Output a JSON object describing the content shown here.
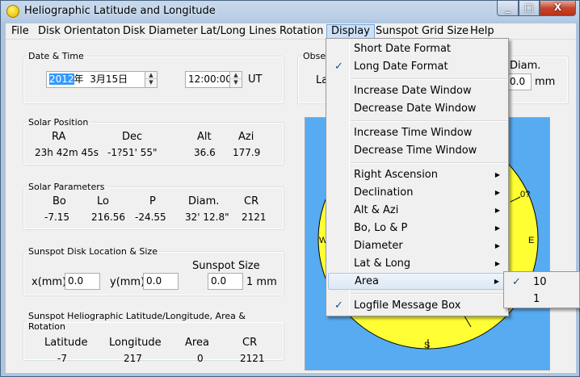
{
  "window": {
    "title": "Heliographic Latitude and Longitude",
    "minimize": "_",
    "maximize": "□",
    "close": "X"
  },
  "menubar": [
    {
      "label": "File"
    },
    {
      "label": "Disk Orientaton"
    },
    {
      "label": "Disk Diameter"
    },
    {
      "label": "Lat/Long Lines"
    },
    {
      "label": "Rotation"
    },
    {
      "label": "Display"
    },
    {
      "label": "Sunspot Grid Size"
    },
    {
      "label": "Help"
    }
  ],
  "date_time": {
    "legend": "Date & Time",
    "year": "2012",
    "year_suffix": "年",
    "month_day": "3月15日",
    "time": "12:00:00",
    "tz": "UT"
  },
  "observer": {
    "legend": "Obser",
    "lat_label": "La",
    "diam_label": "Diam.",
    "diam_value": "0.0",
    "unit": "mm"
  },
  "solar_position": {
    "legend": "Solar Position",
    "headers": [
      "RA",
      "Dec",
      "Alt",
      "Azi"
    ],
    "values": [
      "23h 42m 45s",
      "-1?51' 55\"",
      "36.6",
      "177.9"
    ]
  },
  "solar_parameters": {
    "legend": "Solar Parameters",
    "headers": [
      "Bo",
      "Lo",
      "P",
      "Diam.",
      "CR"
    ],
    "values": [
      "-7.15",
      "216.56",
      "-24.55",
      "32' 12.8\"",
      "2121"
    ]
  },
  "sunspot_location": {
    "legend": "Sunspot Disk Location & Size",
    "x_label": "x(mm)",
    "x_value": "0.0",
    "y_label": "y(mm)",
    "y_value": "0.0",
    "size_label": "Sunspot Size",
    "size_value": "0.0",
    "size_unit": "1 mm"
  },
  "sunspot_result": {
    "legend": "Sunspot Heliographic Latitude/Longitude, Area & Rotation",
    "headers": [
      "Latitude",
      "Longitude",
      "Area",
      "CR"
    ],
    "values": [
      "-7",
      "217",
      "0",
      "2121"
    ]
  },
  "disk": {
    "label_zero": "0?",
    "label_e": "E",
    "label_w": "W",
    "label_s": "S",
    "sun_color": "#ffff33",
    "sky_color": "#57abf0"
  },
  "display_menu": {
    "items": [
      {
        "label": "Short Date Format",
        "checked": ""
      },
      {
        "label": "Long Date Format",
        "checked": "✓"
      },
      {
        "label": "Increase Date Window",
        "checked": ""
      },
      {
        "label": "Decrease Date Window",
        "checked": ""
      },
      {
        "label": "Increase Time Window",
        "checked": ""
      },
      {
        "label": "Decrease Time Window",
        "checked": ""
      },
      {
        "label": "Right Ascension",
        "arrow": "▶"
      },
      {
        "label": "Declination",
        "arrow": "▶"
      },
      {
        "label": "Alt & Azi",
        "arrow": "▶"
      },
      {
        "label": "Bo, Lo & P",
        "arrow": "▶"
      },
      {
        "label": "Diameter",
        "arrow": "▶"
      },
      {
        "label": "Lat & Long",
        "arrow": "▶"
      },
      {
        "label": "Area",
        "arrow": "▶"
      },
      {
        "label": "Logfile Message Box",
        "checked": "✓"
      }
    ]
  },
  "area_submenu": {
    "items": [
      {
        "label": "10",
        "checked": "✓"
      },
      {
        "label": "1",
        "checked": ""
      }
    ]
  }
}
